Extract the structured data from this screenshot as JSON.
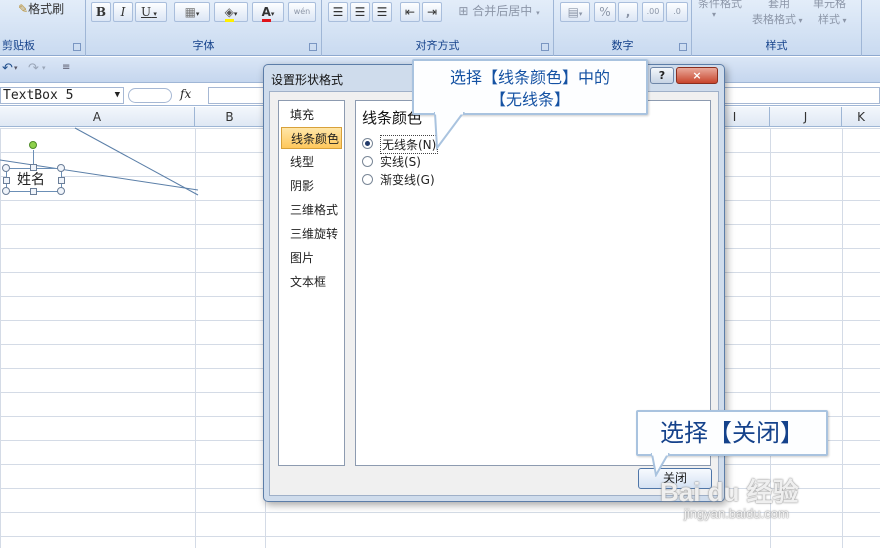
{
  "ribbon": {
    "clipboard": {
      "label": "剪贴板",
      "format_painter": "格式刷"
    },
    "font": {
      "label": "字体",
      "bold": "B",
      "italic": "I",
      "underline": "U",
      "phonetic": "wén"
    },
    "alignment": {
      "label": "对齐方式",
      "merge_center": "合并后居中"
    },
    "number": {
      "label": "数字",
      "percent": "%",
      "comma": ","
    },
    "styles": {
      "label": "样式",
      "conditional_format": "条件格式",
      "table_format_top": "套用",
      "table_format": "表格格式",
      "cell_style_top": "单元格",
      "cell_style": "样式"
    }
  },
  "formula_bar": {
    "name_box": "TextBox 5",
    "fx": "fx"
  },
  "columns": [
    "A",
    "B",
    "I",
    "J",
    "K"
  ],
  "textbox": {
    "text": "姓名"
  },
  "dialog": {
    "title": "设置形状格式",
    "help_button": "?",
    "close_x": "×",
    "nav_items": [
      "填充",
      "线条颜色",
      "线型",
      "阴影",
      "三维格式",
      "三维旋转",
      "图片",
      "文本框"
    ],
    "selected_nav": "线条颜色",
    "panel_title": "线条颜色",
    "options": [
      {
        "label": "无线条(N)",
        "checked": true
      },
      {
        "label": "实线(S)",
        "checked": false
      },
      {
        "label": "渐变线(G)",
        "checked": false
      }
    ],
    "close_button": "关闭"
  },
  "callouts": {
    "top_line1": "选择【线条颜色】中的",
    "top_line2": "【无线条】",
    "bottom": "选择【关闭】"
  },
  "watermark": {
    "brand": "Bai du 经验",
    "url": "jingyan.baidu.com"
  }
}
